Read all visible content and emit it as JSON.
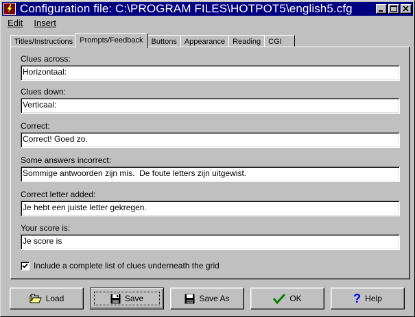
{
  "window": {
    "title": "Configuration file: C:\\PROGRAM FILES\\HOTPOT5\\english5.cfg"
  },
  "menu": [
    {
      "label": "Edit"
    },
    {
      "label": "Insert"
    }
  ],
  "tabs": [
    {
      "label": "Titles/Instructions"
    },
    {
      "label": "Prompts/Feedback",
      "active": true
    },
    {
      "label": "Buttons"
    },
    {
      "label": "Appearance"
    },
    {
      "label": "Reading"
    },
    {
      "label": "CGI"
    }
  ],
  "fields": [
    {
      "label": "Clues across:",
      "value": "Horizontaal:"
    },
    {
      "label": "Clues down:",
      "value": "Verticaal:"
    },
    {
      "label": "Correct:",
      "value": "Correct! Goed zo."
    },
    {
      "label": "Some answers incorrect:",
      "value": "Sommige antwoorden zijn mis.  De foute letters zijn uitgewist."
    },
    {
      "label": "Correct letter added:",
      "value": "Je hebt een juiste letter gekregen."
    },
    {
      "label": "Your score is:",
      "value": "Je score is"
    }
  ],
  "checkbox": {
    "label": "Include a complete list of clues underneath the grid",
    "checked": true
  },
  "buttons": {
    "load": "Load",
    "save": "Save",
    "save_as": "Save As",
    "ok": "OK",
    "help": "Help"
  },
  "colors": {
    "titlebar": "#000080",
    "face": "#c0c0c0",
    "ok_check": "#008000",
    "help_question": "#0000ff"
  }
}
